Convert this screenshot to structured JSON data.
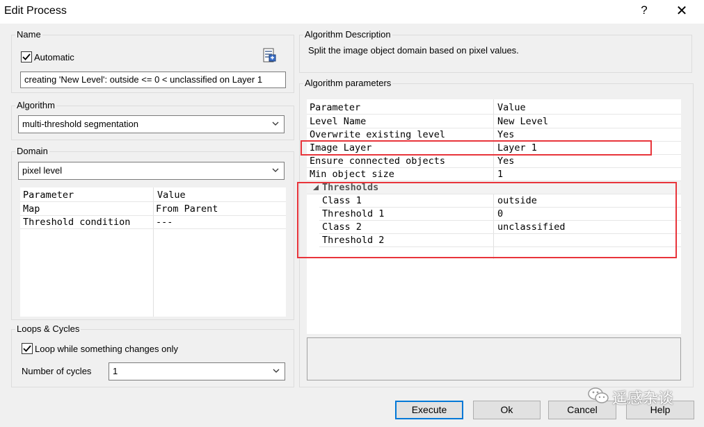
{
  "window": {
    "title": "Edit Process",
    "help": "?",
    "close": "✕"
  },
  "name_group": {
    "label": "Name",
    "automatic_label": "Automatic",
    "automatic_checked": true,
    "name_value": "creating 'New Level': outside <= 0 < unclassified on Layer 1"
  },
  "algorithm_group": {
    "label": "Algorithm",
    "value": "multi-threshold segmentation"
  },
  "domain_group": {
    "label": "Domain",
    "value": "pixel level",
    "headers": {
      "param": "Parameter",
      "value": "Value"
    },
    "rows": [
      {
        "param": "Map",
        "value": "From Parent"
      },
      {
        "param": "Threshold condition",
        "value": "---"
      }
    ]
  },
  "loops_group": {
    "label": "Loops & Cycles",
    "loop_label": "Loop while something changes only",
    "loop_checked": true,
    "cycles_label": "Number of cycles",
    "cycles_value": "1"
  },
  "description_group": {
    "label": "Algorithm Description",
    "text": "Split the image object domain based on pixel values."
  },
  "params_group": {
    "label": "Algorithm parameters",
    "headers": {
      "param": "Parameter",
      "value": "Value"
    },
    "rows": [
      {
        "param": "Level Name",
        "value": "New Level"
      },
      {
        "param": "Overwrite existing level",
        "value": "Yes"
      },
      {
        "param": "Image Layer",
        "value": "Layer 1"
      },
      {
        "param": "Ensure connected objects",
        "value": "Yes"
      },
      {
        "param": "Min object size",
        "value": "1"
      }
    ],
    "thresholds_label": "Thresholds",
    "threshold_rows": [
      {
        "param": "Class 1",
        "value": "outside"
      },
      {
        "param": "Threshold 1",
        "value": "0"
      },
      {
        "param": "Class 2",
        "value": "unclassified"
      },
      {
        "param": "Threshold 2",
        "value": ""
      }
    ]
  },
  "buttons": {
    "execute": "Execute",
    "ok": "Ok",
    "cancel": "Cancel",
    "help": "Help"
  },
  "watermark": "遥感杂谈"
}
